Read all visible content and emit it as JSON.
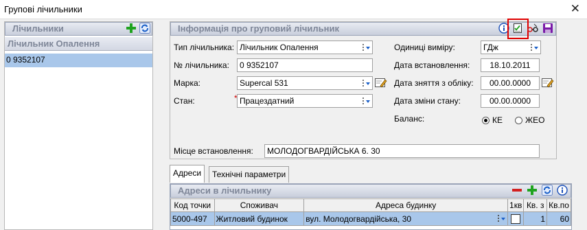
{
  "window": {
    "title": "Групові лічильники",
    "close_glyph": "✕"
  },
  "left": {
    "header": "Лічильники",
    "column": "Лічильник Опалення",
    "rows": [
      "0 9352107"
    ]
  },
  "info": {
    "header": "Інформація про груповий лічильник",
    "type_label": "Тип лічильника:",
    "type_value": "Лічильник Опалення",
    "number_label": "№ лічильника:",
    "number_value": "0 9352107",
    "brand_label": "Марка:",
    "brand_value": "Supercal 531",
    "state_label": "Стан:",
    "state_required": "*",
    "state_value": "Працездатний",
    "units_label": "Одиниці виміру:",
    "units_value": "ГДж",
    "install_date_label": "Дата встановлення:",
    "install_date_value": "18.10.2011",
    "removal_date_label": "Дата зняття з обліку:",
    "removal_date_value": "00.00.0000",
    "state_change_label": "Дата зміни стану:",
    "state_change_value": "00.00.0000",
    "balance_label": "Баланс:",
    "balance_options": [
      "КЕ",
      "ЖЕО"
    ],
    "location_label": "Місце встановлення:",
    "location_value": "МОЛОДОГВАРДІЙСЬКА 6. 30"
  },
  "tabs": [
    "Адреси",
    "Технічні параметри"
  ],
  "addresses": {
    "header": "Адреси в лічильнику",
    "columns": [
      "Код точки",
      "Споживач",
      "Адреса будинку",
      "1кв",
      "Кв. з",
      "Кв.по"
    ],
    "rows": [
      {
        "code": "5000-497",
        "consumer": "Житловий будинок",
        "address": "вул. Молодогвардійська, 30",
        "apt_from": "1",
        "apt_to": "60"
      }
    ]
  },
  "colors": {
    "selected_row": "#a9c7ea",
    "header_text": "#7e8698",
    "highlight_border": "#e00000",
    "add_green": "#1fa31f",
    "refresh_blue": "#1a5fc8",
    "remove_red": "#d32020"
  }
}
